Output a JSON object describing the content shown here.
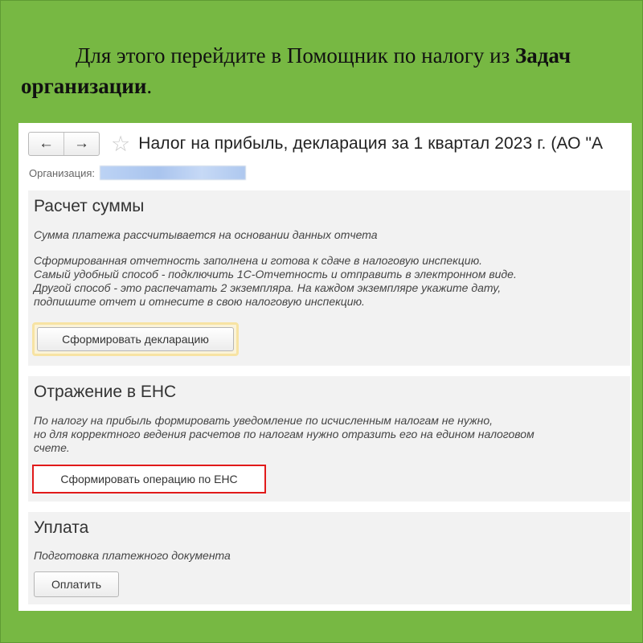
{
  "caption": {
    "part1": "Для этого перейдите в Помощник по налогу из ",
    "bold1": "Задач",
    "bold2": "организации",
    "end": "."
  },
  "window": {
    "back_icon": "←",
    "forward_icon": "→",
    "star_icon": "☆",
    "title": "Налог на прибыль, декларация за 1 квартал 2023 г. (АО \"А",
    "org_label": "Организация:"
  },
  "sections": {
    "calc": {
      "title": "Расчет суммы",
      "line1": "Сумма платежа рассчитывается на основании данных отчета",
      "line2": "Сформированная отчетность заполнена и готова к сдаче в налоговую инспекцию.",
      "line3": "Самый удобный способ - подключить 1С-Отчетность и отправить в электронном виде.",
      "line4": "Другой способ - это распечатать 2 экземпляра. На каждом экземпляре укажите дату,",
      "line5": "подпишите отчет и отнесите в свою налоговую инспекцию.",
      "button": "Сформировать декларацию"
    },
    "ens": {
      "title": "Отражение в ЕНС",
      "line1": "По налогу на прибыль формировать уведомление по исчисленным налогам не нужно,",
      "line2": "но для корректного ведения расчетов по налогам нужно отразить его на едином налоговом",
      "line3": "счете.",
      "button": "Сформировать операцию по ЕНС"
    },
    "pay": {
      "title": "Уплата",
      "line1": "Подготовка платежного документа",
      "button": "Оплатить"
    }
  },
  "colors": {
    "background": "#77b843",
    "highlight_red": "#e11a1a",
    "highlight_yellow": "#f7e3a3"
  }
}
